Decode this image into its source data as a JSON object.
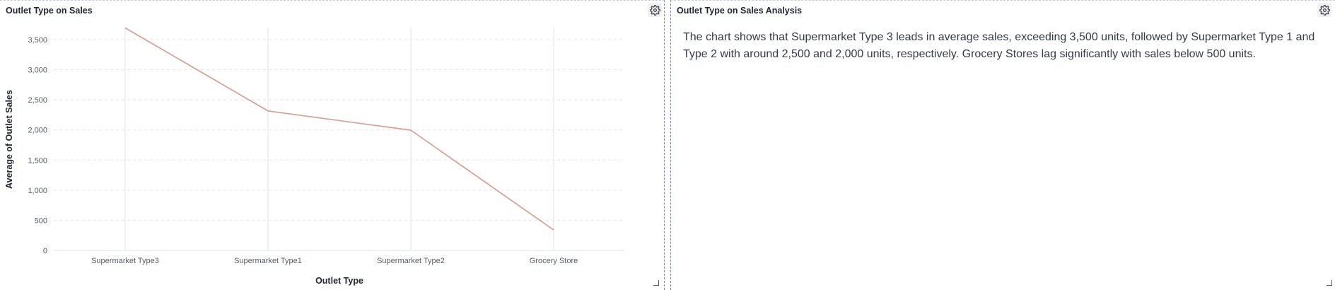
{
  "chart_panel": {
    "title": "Outlet Type on Sales"
  },
  "text_panel": {
    "title": "Outlet Type on Sales Analysis",
    "body": "The chart shows that Supermarket Type 3 leads in average sales, exceeding 3,500 units, followed by Supermarket Type 1 and Type 2 with around 2,500 and 2,000 units, respectively. Grocery Stores lag significantly with sales below 500 units."
  },
  "icons": {
    "settings": "gear-icon",
    "resize": "resize-corner-icon"
  },
  "colors": {
    "line": "#d4a59a",
    "grid": "#e4e4ea",
    "divider": "#7a86b8"
  },
  "chart_data": {
    "type": "line",
    "title": "",
    "xlabel": "Outlet Type",
    "ylabel": "Average of Outlet Sales",
    "categories": [
      "Supermarket Type3",
      "Supermarket Type1",
      "Supermarket Type2",
      "Grocery Store"
    ],
    "values": [
      3695,
      2316,
      1996,
      340
    ],
    "ylim": [
      0,
      3700
    ],
    "yticks": [
      0,
      500,
      1000,
      1500,
      2000,
      2500,
      3000,
      3500
    ],
    "ytick_labels": [
      "0",
      "500",
      "1,000",
      "1,500",
      "2,000",
      "2,500",
      "3,000",
      "3,500"
    ],
    "grid": true
  }
}
